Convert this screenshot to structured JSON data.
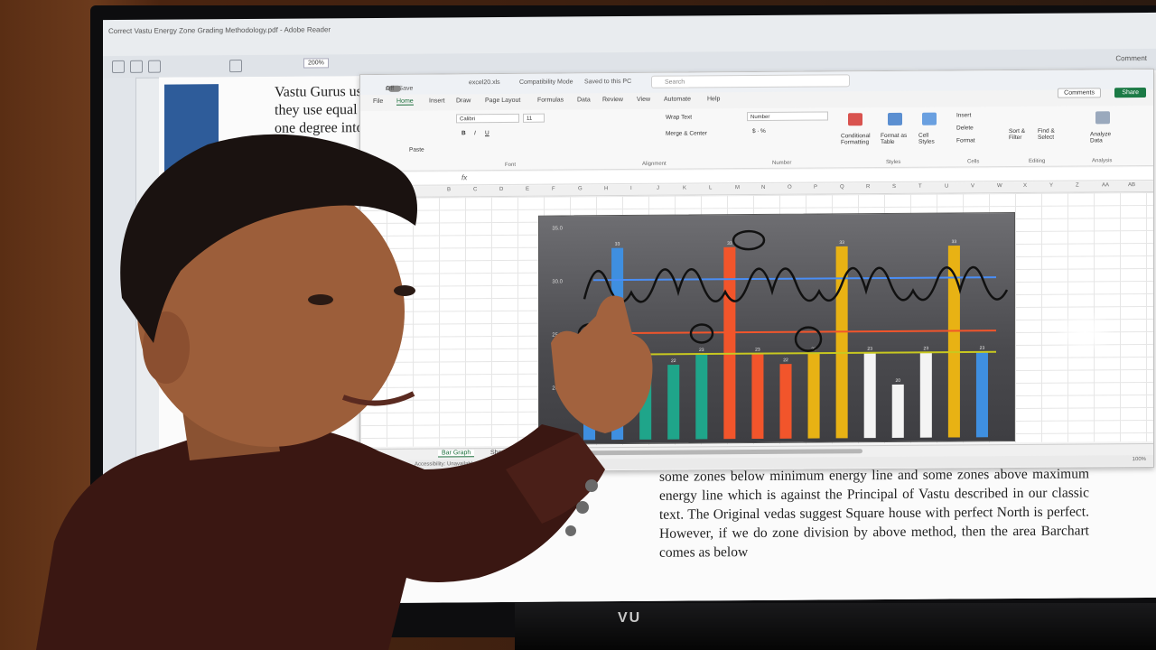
{
  "pdf": {
    "title": "Correct Vastu Energy Zone Grading Methodology.pdf - Adobe Reader",
    "zoom": "200%",
    "page": "1",
    "text_top": [
      "Vastu Gurus uses angular",
      "they use equal division",
      "one degree into 16 Zones"
    ],
    "text_bottom": "some zones below minimum energy line and some zones above maximum energy line which is against the Principal of Vastu described in our classic text. The Original vedas suggest Square house with perfect North is perfect. However, if we do zone division by above method, then the area Barchart comes as below",
    "comment_label": "Comment"
  },
  "excel": {
    "autosave": "AutoSave",
    "autosave_state": "Off",
    "file": "excel20.xls",
    "mode": "Compatibility Mode",
    "saved": "Saved to this PC",
    "search": "Search",
    "tabs": [
      "File",
      "Home",
      "Insert",
      "Draw",
      "Page Layout",
      "Formulas",
      "Data",
      "Review",
      "View",
      "Automate",
      "Help"
    ],
    "active_tab": "Home",
    "comments": "Comments",
    "share": "Share",
    "ribbon": {
      "font_name": "Calibri",
      "font_size": "11",
      "font_group": "Font",
      "alignment_group": "Alignment",
      "number_group": "Number",
      "styles_group": "Styles",
      "cells_group": "Cells",
      "editing_group": "Editing",
      "analysis_group": "Analysis",
      "wrap_text": "Wrap Text",
      "merge_center": "Merge & Center",
      "number_format": "Number",
      "conditional": "Conditional Formatting",
      "format_table": "Format as Table",
      "cell_styles": "Cell Styles",
      "insert": "Insert",
      "delete": "Delete",
      "format": "Format",
      "sort_filter": "Sort & Filter",
      "find_select": "Find & Select",
      "analyze": "Analyze Data",
      "paste": "Paste"
    },
    "fx": "fx",
    "columns": [
      "B",
      "C",
      "D",
      "E",
      "F",
      "G",
      "H",
      "I",
      "J",
      "K",
      "L",
      "M",
      "N",
      "O",
      "P",
      "Q",
      "R",
      "S",
      "T",
      "U",
      "V",
      "W",
      "X",
      "Y",
      "Z",
      "AA",
      "AB"
    ],
    "sheets": [
      "Bar Graph",
      "Sheet1"
    ],
    "active_sheet": "Bar Graph",
    "status": "Accessibility: Unavailable",
    "zoom": "100%"
  },
  "tv_brand": "VU",
  "chart_data": {
    "type": "bar",
    "ylim": [
      15,
      35
    ],
    "yticks": [
      "35.0",
      "30.0",
      "25.0",
      "20.0"
    ],
    "values": [
      20,
      33,
      23,
      22,
      23,
      33,
      23,
      22,
      23,
      33,
      23,
      20,
      23,
      33,
      23
    ],
    "colors": [
      "#3f8fe0",
      "#3f8fe0",
      "#1fa58a",
      "#1fa58a",
      "#1fa58a",
      "#f2552b",
      "#f2552b",
      "#f2552b",
      "#e8b214",
      "#e8b214",
      "#f4f4f4",
      "#f4f4f4",
      "#f4f4f4",
      "#e8b214",
      "#3f8fe0"
    ],
    "reference_lines": [
      {
        "value": 30,
        "color": "#4a8ef5"
      },
      {
        "value": 25,
        "color": "#f2552b"
      },
      {
        "value": 23,
        "color": "#c8c820"
      }
    ]
  }
}
